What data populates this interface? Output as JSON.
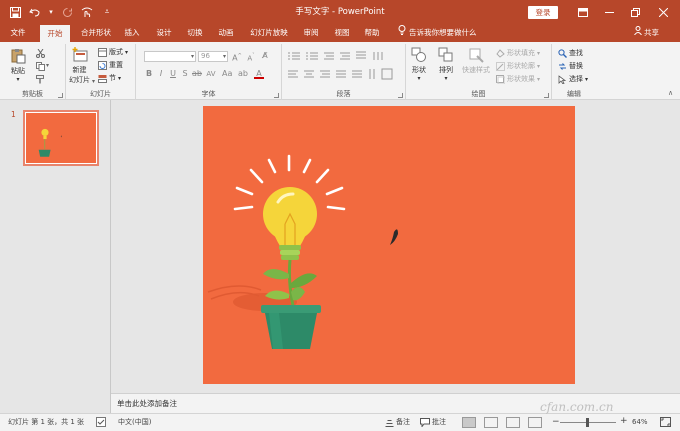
{
  "titlebar": {
    "title": "手写文字  -  PowerPoint",
    "login": "登录",
    "qat": [
      "save-icon",
      "undo-icon",
      "redo-icon",
      "touch-mode-icon",
      "customize-icon"
    ]
  },
  "tabs": [
    "文件",
    "开始",
    "合并形状",
    "插入",
    "设计",
    "切换",
    "动画",
    "幻灯片放映",
    "审阅",
    "视图",
    "帮助"
  ],
  "active_tab": "开始",
  "tell_me": "告诉我你想要做什么",
  "share": "共享",
  "ribbon": {
    "clipboard": {
      "label": "剪贴板",
      "paste": "粘贴"
    },
    "slides": {
      "label": "幻灯片",
      "new_slide_1": "新建",
      "new_slide_2": "幻灯片",
      "layout": "版式",
      "reset": "重置",
      "section": "节"
    },
    "font": {
      "label": "字体",
      "size": "96"
    },
    "paragraph": {
      "label": "段落"
    },
    "drawing": {
      "label": "绘图",
      "shapes": "形状",
      "arrange": "排列",
      "quick_styles": "快速样式",
      "fill": "形状填充",
      "outline": "形状轮廓",
      "effect": "形状效果"
    },
    "editing": {
      "label": "编辑",
      "find": "查找",
      "replace": "替换",
      "select": "选择"
    }
  },
  "thumbnail": {
    "number": "1"
  },
  "notes_placeholder": "单击此处添加备注",
  "status": {
    "slide_info": "幻灯片 第 1 张，共 1 张",
    "language": "中文(中国)",
    "notes": "备注",
    "comments": "批注",
    "zoom": "64%"
  },
  "watermark": "cfan.com.cn",
  "colors": {
    "accent": "#b7472a",
    "slide_bg": "#f26a3f",
    "bulb": "#f5d53a",
    "pot": "#2d8a68"
  }
}
